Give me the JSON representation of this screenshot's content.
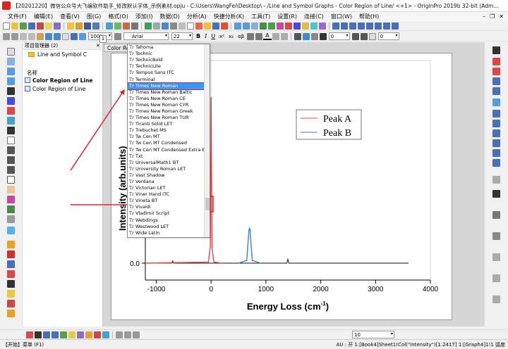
{
  "window": {
    "title": "【20201220】微信公众号大飞编软件助手_修改默认字体_示例素材.opju - C:\\Users\\WangFei\\Desktop\\ - /Line and Symbol Graphs - Color Region of Line/ <+1> - OriginPro 2019b 32-bit (Adm..."
  },
  "menu": {
    "items": [
      "文件(F)",
      "编辑(E)",
      "查看(V)",
      "图(G)",
      "格式(O)",
      "添加(I)",
      "数据(D)",
      "分析(A)",
      "快捷分析(K)",
      "工具(T)",
      "设置(R)",
      "连接(C)",
      "窗口(W)",
      "帮助(H)"
    ]
  },
  "toolbar": {
    "zoom": "100%",
    "font": "Arial",
    "font_size": "22",
    "bold": "B",
    "italic": "I",
    "underline": "U",
    "superscript": "x²",
    "subscript": "x₂",
    "greek": "αβ",
    "text_a": "A",
    "line_width": "0",
    "fill_pct": "0"
  },
  "project_manager": {
    "header": "项目管理器 (2)",
    "folder": "Line and Symbol C",
    "column_header": "名称",
    "items": [
      {
        "label": "Color Region of Line",
        "bold": true
      },
      {
        "label": "Color Region of Line",
        "bold": false
      }
    ]
  },
  "graph": {
    "tab_label": "Color Re",
    "layer_number": "1",
    "legend": [
      "Peak A",
      "Peak B"
    ],
    "xlabel": "Energy Loss (cm",
    "xlabel_sup": "-1",
    "xlabel_end": ")",
    "ylabel": "Intensity (arb.units)"
  },
  "font_dropdown": {
    "items": [
      "Tahoma",
      "Technic",
      "TechnicBold",
      "TechnicLite",
      "Tempus Sans ITC",
      "Terminal",
      "Times New Roman",
      "Times New Roman Baltic",
      "Times New Roman CE",
      "Times New Roman CYR",
      "Times New Roman Greek",
      "Times New Roman TUR",
      "Tiranti Solid LET",
      "Trebuchet MS",
      "Tw Cen MT",
      "Tw Cen MT Condensed",
      "Tw Cen MT Condensed Extra Bol",
      "Txt",
      "UniversalMath1 BT",
      "University Roman LET",
      "Vast Shadow",
      "Verdana",
      "Victorian LET",
      "Viner Hand ITC",
      "Vineta BT",
      "Vivaldi",
      "Vladimir Script",
      "Webdings",
      "Westwood LET",
      "Wide Latin"
    ],
    "selected_index": 6,
    "icon_text": "Tr"
  },
  "bottom_toolbar": {
    "zoom": "10"
  },
  "status": {
    "left": "【开始】菜单 (F1)",
    "right": "AU : 开   1:[Book4]Sheet1!Col(\"Intensity\")[1:2417]   1:[Graph4]1!1   弧度"
  },
  "colors": {
    "peak_a": "#e8494b",
    "peak_b": "#3d7fd6",
    "baseline": "#111111",
    "arrow": "#e0262a",
    "selection": "#3399ff"
  },
  "chart_data": {
    "type": "line",
    "xlim": [
      -1200,
      4000
    ],
    "xticks": [
      -1000,
      0,
      1000,
      2000,
      3000,
      4000
    ],
    "ytick_labels": [
      "0.0"
    ],
    "series": [
      {
        "name": "Peak A",
        "color": "#e8494b",
        "x": [
          -1200,
          -50,
          -15,
          0,
          15,
          50,
          200
        ],
        "y": [
          0.0,
          0.02,
          0.3,
          3.0,
          0.3,
          0.02,
          0.0
        ]
      },
      {
        "name": "Peak B",
        "color": "#3d7fd6",
        "x": [
          500,
          650,
          690,
          700,
          710,
          750,
          900
        ],
        "y": [
          0.0,
          0.05,
          0.6,
          0.63,
          0.6,
          0.05,
          0.0
        ]
      }
    ],
    "baseline": {
      "x": [
        -1200,
        -720,
        -700,
        -680,
        200,
        500,
        900,
        1380,
        1400,
        1420,
        3600
      ],
      "y": [
        0.0,
        0.0,
        0.04,
        0.0,
        0.0,
        0.0,
        0.0,
        0.0,
        0.07,
        0.0,
        0.0
      ]
    }
  }
}
